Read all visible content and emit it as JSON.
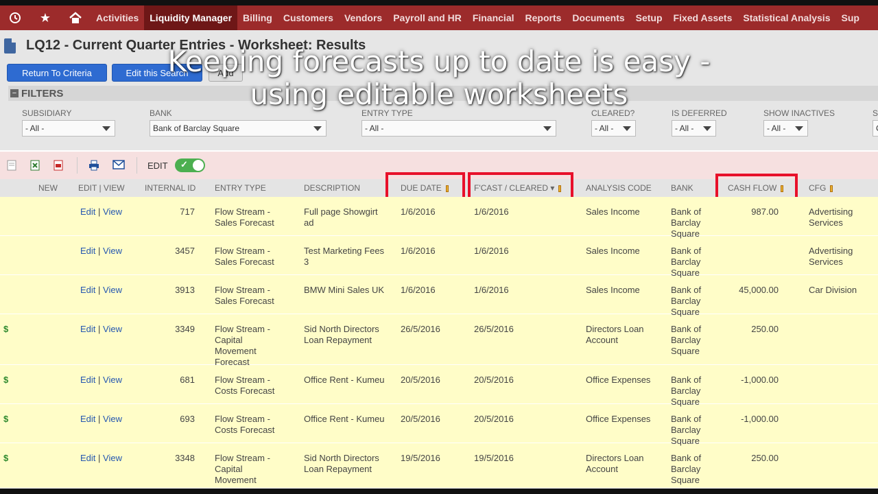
{
  "nav": {
    "items": [
      "Activities",
      "Liquidity Manager",
      "Billing",
      "Customers",
      "Vendors",
      "Payroll and HR",
      "Financial",
      "Reports",
      "Documents",
      "Setup",
      "Fixed Assets",
      "Statistical Analysis",
      "Sup"
    ],
    "active": "Liquidity Manager"
  },
  "page": {
    "title": "LQ12 - Current Quarter Entries - Worksheet: Results"
  },
  "buttons": {
    "return": "Return To Criteria",
    "edit_search": "Edit this Search",
    "add": "Add"
  },
  "filters": {
    "heading": "FILTERS",
    "toggle": "−",
    "subsidiary": {
      "label": "SUBSIDIARY",
      "value": "- All -"
    },
    "bank": {
      "label": "BANK",
      "value": "Bank of Barclay Square"
    },
    "entry_type": {
      "label": "ENTRY TYPE",
      "value": "- All -"
    },
    "cleared": {
      "label": "CLEARED?",
      "value": "- All -"
    },
    "deferred": {
      "label": "IS DEFERRED",
      "value": "- All -"
    },
    "inactives": {
      "label": "SHOW INACTIVES",
      "value": "- All -"
    },
    "extra": {
      "label": "S",
      "value": "C"
    }
  },
  "toolbar": {
    "edit_label": "EDIT"
  },
  "table": {
    "headers": {
      "new": "NEW",
      "edit_view": "EDIT | VIEW",
      "internal_id": "INTERNAL ID",
      "entry_type": "ENTRY TYPE",
      "description": "DESCRIPTION",
      "due_date": "DUE DATE",
      "fcast_cleared": "F'CAST / CLEARED ▾",
      "analysis_code": "ANALYSIS CODE",
      "bank": "BANK",
      "cash_flow": "CASH FLOW",
      "cfg": "CFG"
    },
    "edit_text": "Edit",
    "sep_text": " | ",
    "view_text": "View",
    "rows": [
      {
        "dollar": "",
        "id": "717",
        "entry_type": "Flow Stream - Sales Forecast",
        "description": "Full page Showgirt ad",
        "due": "1/6/2016",
        "fcast": "1/6/2016",
        "analysis": "Sales Income",
        "bank": "Bank of Barclay Square",
        "cash": "987.00",
        "cfg": "Advertising Services"
      },
      {
        "dollar": "",
        "id": "3457",
        "entry_type": "Flow Stream - Sales Forecast",
        "description": "Test Marketing Fees 3",
        "due": "1/6/2016",
        "fcast": "1/6/2016",
        "analysis": "Sales Income",
        "bank": "Bank of Barclay Square",
        "cash": "",
        "cfg": "Advertising Services"
      },
      {
        "dollar": "",
        "id": "3913",
        "entry_type": "Flow Stream - Sales Forecast",
        "description": "BMW Mini Sales UK",
        "due": "1/6/2016",
        "fcast": "1/6/2016",
        "analysis": "Sales Income",
        "bank": "Bank of Barclay Square",
        "cash": "45,000.00",
        "cfg": "Car Division"
      },
      {
        "dollar": "$",
        "id": "3349",
        "entry_type": "Flow Stream - Capital Movement Forecast",
        "description": "Sid North Directors Loan Repayment",
        "due": "26/5/2016",
        "fcast": "26/5/2016",
        "analysis": "Directors Loan Account",
        "bank": "Bank of Barclay Square",
        "cash": "250.00",
        "cfg": ""
      },
      {
        "dollar": "$",
        "id": "681",
        "entry_type": "Flow Stream - Costs Forecast",
        "description": "Office Rent - Kumeu",
        "due": "20/5/2016",
        "fcast": "20/5/2016",
        "analysis": "Office Expenses",
        "bank": "Bank of Barclay Square",
        "cash": "-1,000.00",
        "cfg": ""
      },
      {
        "dollar": "$",
        "id": "693",
        "entry_type": "Flow Stream - Costs Forecast",
        "description": "Office Rent - Kumeu",
        "due": "20/5/2016",
        "fcast": "20/5/2016",
        "analysis": "Office Expenses",
        "bank": "Bank of Barclay Square",
        "cash": "-1,000.00",
        "cfg": ""
      },
      {
        "dollar": "$",
        "id": "3348",
        "entry_type": "Flow Stream - Capital Movement",
        "description": "Sid North Directors Loan Repayment",
        "due": "19/5/2016",
        "fcast": "19/5/2016",
        "analysis": "Directors Loan Account",
        "bank": "Bank of Barclay Square",
        "cash": "250.00",
        "cfg": ""
      }
    ]
  },
  "caption": {
    "line1": "Keeping forecasts up to date is easy -",
    "line2": "using editable worksheets"
  }
}
